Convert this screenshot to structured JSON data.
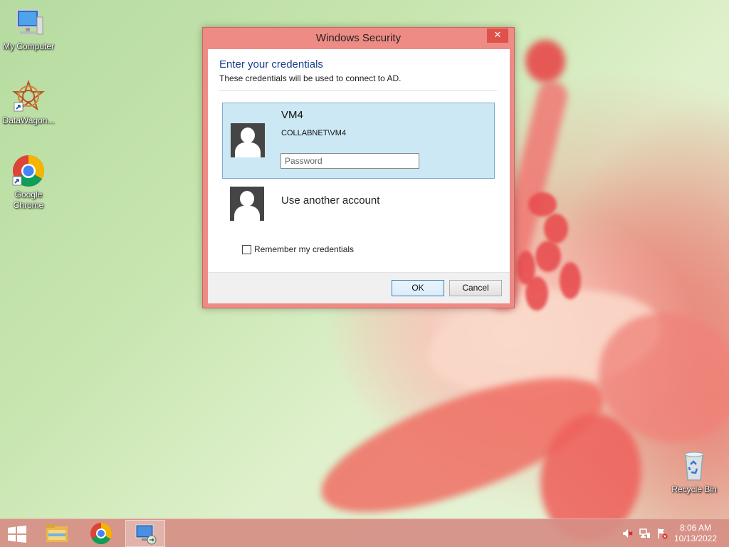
{
  "desktop": {
    "icons": [
      {
        "label": "My Computer",
        "icon": "computer-icon"
      },
      {
        "label": "DataWagon...",
        "icon": "datawagon-icon"
      },
      {
        "label": "Google Chrome",
        "icon": "chrome-icon"
      },
      {
        "label": "Recycle Bin",
        "icon": "recycle-bin-icon"
      }
    ]
  },
  "dialog": {
    "title": "Windows Security",
    "close_glyph": "✕",
    "heading": "Enter your credentials",
    "subheading": "These credentials will be used to connect to AD.",
    "selected_account": {
      "name": "VM4",
      "domain": "COLLABNET\\VM4",
      "password_placeholder": "Password",
      "password_value": ""
    },
    "other_account_label": "Use another account",
    "remember_label": "Remember my credentials",
    "remember_checked": false,
    "ok_label": "OK",
    "cancel_label": "Cancel"
  },
  "taskbar": {
    "items": [
      {
        "icon": "file-explorer-icon",
        "active": false
      },
      {
        "icon": "chrome-icon",
        "active": false
      },
      {
        "icon": "remote-desktop-icon",
        "active": true
      }
    ],
    "tray": [
      "volume-muted-icon",
      "network-icon",
      "action-center-icon"
    ],
    "time": "8:06 AM",
    "date": "10/13/2022"
  },
  "colors": {
    "dialog_frame": "#ee8b85",
    "heading_blue": "#1a3e8c",
    "selected_bg": "#cce8f4",
    "taskbar": "#d68e84"
  }
}
